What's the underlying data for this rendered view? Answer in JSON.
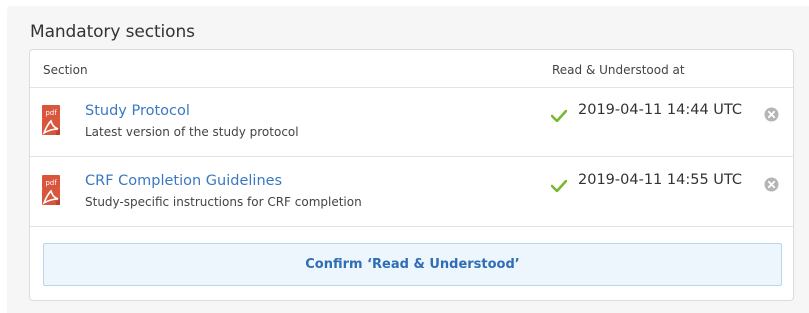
{
  "panel": {
    "title": "Mandatory sections"
  },
  "table": {
    "headers": {
      "section": "Section",
      "read": "Read & Understood at"
    },
    "rows": [
      {
        "icon": "pdf-icon",
        "title": "Study Protocol",
        "description": "Latest version of the study protocol",
        "status_icon": "check-icon",
        "timestamp": "2019-04-11 14:44 UTC",
        "clear_icon": "clear-circle-icon"
      },
      {
        "icon": "pdf-icon",
        "title": "CRF Completion Guidelines",
        "description": "Study-specific instructions for CRF completion",
        "status_icon": "check-icon",
        "timestamp": "2019-04-11 14:55 UTC",
        "clear_icon": "clear-circle-icon"
      }
    ]
  },
  "confirm_button": {
    "label": "Confirm ‘Read & Understood’"
  },
  "colors": {
    "link": "#3a78c3",
    "pdf_red": "#d9553b",
    "check_green": "#7ab82f",
    "clear_gray": "#b5b5b5",
    "button_bg": "#edf6fd",
    "button_text": "#2f6db5"
  }
}
